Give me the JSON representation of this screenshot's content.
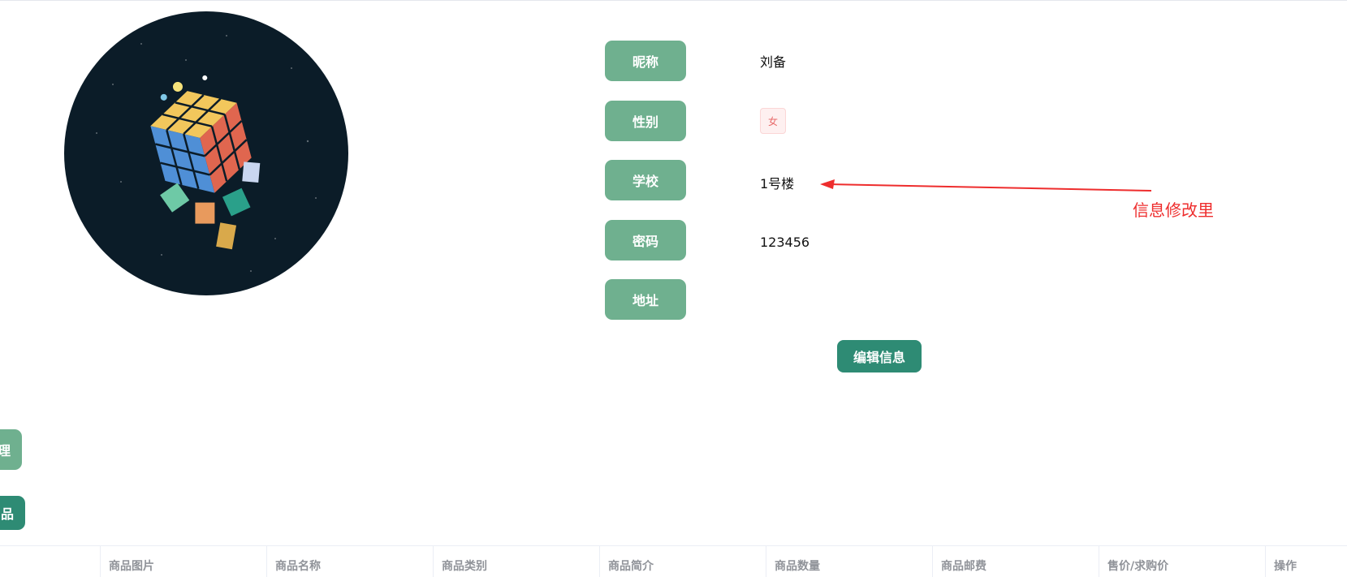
{
  "profile": {
    "fields": [
      {
        "label": "昵称",
        "value": "刘备"
      },
      {
        "label": "性别",
        "value": "女"
      },
      {
        "label": "学校",
        "value": "1号楼"
      },
      {
        "label": "密码",
        "value": "123456"
      },
      {
        "label": "地址",
        "value": ""
      }
    ],
    "edit_button": "编辑信息"
  },
  "annotation": {
    "text": "信息修改里",
    "color": "#ee2d2d"
  },
  "side_buttons": {
    "manage": "理",
    "goods": "品"
  },
  "table": {
    "columns": [
      "商品图片",
      "商品名称",
      "商品类别",
      "商品简介",
      "商品数量",
      "商品邮费",
      "售价/求购价",
      "操作"
    ]
  },
  "colors": {
    "label_bg": "#6fb08f",
    "primary_button": "#2e8b74",
    "avatar_bg": "#0b1c28"
  }
}
